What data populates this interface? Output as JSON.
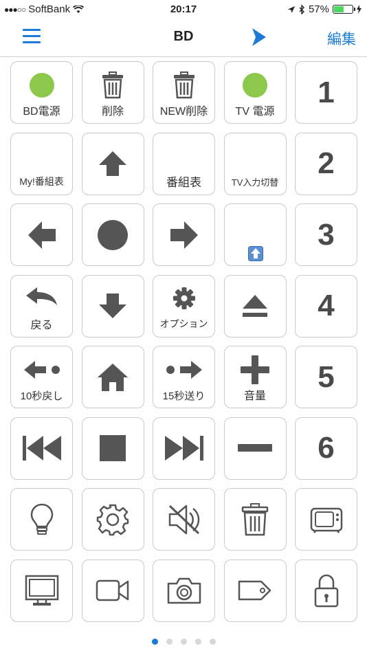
{
  "status_bar": {
    "carrier": "SoftBank",
    "signal_dots": "●●●○○",
    "time": "20:17",
    "battery_percent": "57%",
    "battery_level": 0.57
  },
  "navbar": {
    "title": "BD",
    "edit_label": "編集"
  },
  "keys": {
    "bd_power": "BD電源",
    "delete": "削除",
    "new_delete": "NEW削除",
    "tv_power": "TV 電源",
    "num1": "1",
    "my_guide": "My!番組表",
    "guide": "番組表",
    "tv_input": "TV入力切替",
    "num2": "2",
    "num3": "3",
    "back": "戻る",
    "option": "オプション",
    "num4": "4",
    "rewind10": "10秒戻し",
    "forward15": "15秒送り",
    "volume": "音量",
    "num5": "5",
    "num6": "6"
  },
  "icons": {
    "power_indicator": "green-circle",
    "arrow": "arrow-icon",
    "transport": "media-transport-icons",
    "row7": [
      "bulb-icon",
      "gear-icon",
      "mute-icon",
      "trash-icon",
      "tv-icon"
    ],
    "row8": [
      "monitor-icon",
      "video-camera-icon",
      "camera-icon",
      "tag-icon",
      "lock-icon"
    ]
  },
  "colors": {
    "accent": "#1c7cd5",
    "power_green": "#8cc84b",
    "icon_gray": "#555555"
  },
  "pager": {
    "pages": 5,
    "active": 1
  }
}
